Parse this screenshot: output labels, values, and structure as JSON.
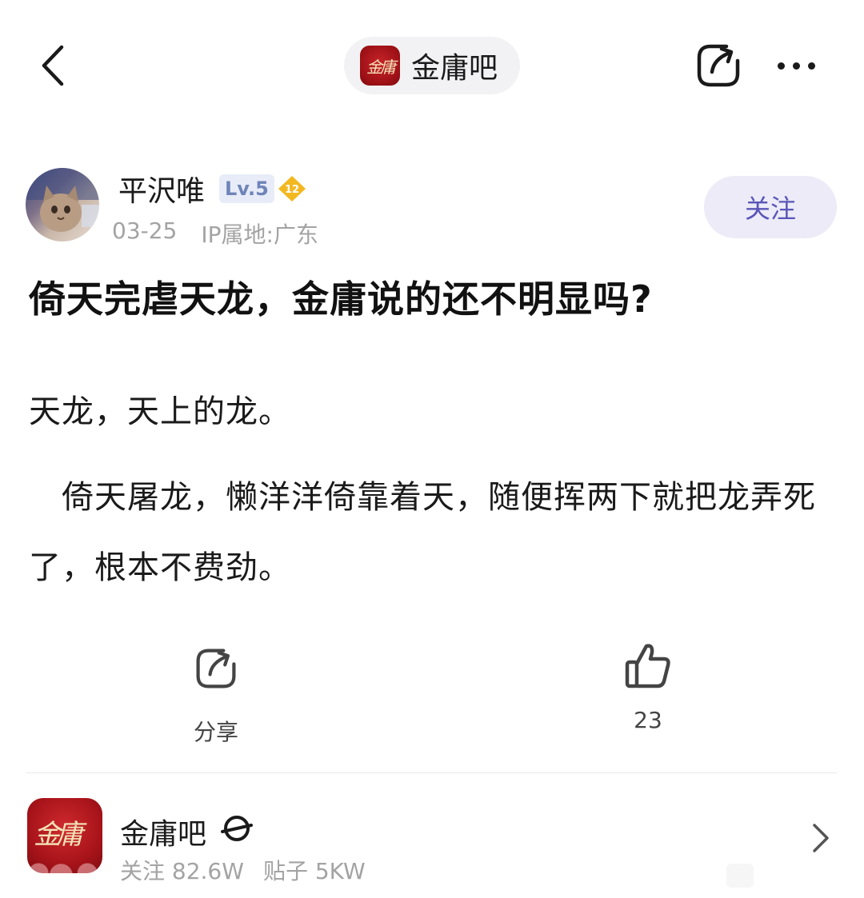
{
  "topbar": {
    "forum_label": "金庸吧",
    "forum_logo_text": "金庸"
  },
  "author": {
    "name": "平沢唯",
    "level": "Lv.5",
    "rank": "12",
    "date": "03-25",
    "ip": "IP属地:广东",
    "follow_label": "关注"
  },
  "post": {
    "title": "倚天完虐天龙，金庸说的还不明显吗?",
    "paragraph1": "天龙，天上的龙。",
    "paragraph2": "　倚天屠龙，懒洋洋倚靠着天，随便挥两下就把龙弄死了，根本不费劲。"
  },
  "actions": {
    "share_label": "分享",
    "like_count": "23"
  },
  "forum_card": {
    "name": "金庸吧",
    "logo_text": "金庸",
    "followers": "关注 82.6W",
    "posts": "贴子 5KW"
  },
  "colors": {
    "follow_text": "#5a55b8",
    "follow_bg": "#ecebf7",
    "level_badge_bg": "#e7ecf8",
    "level_badge_text": "#6f84b8",
    "rank_badge": "#f3b820",
    "forum_logo_red": "#a8141a"
  }
}
